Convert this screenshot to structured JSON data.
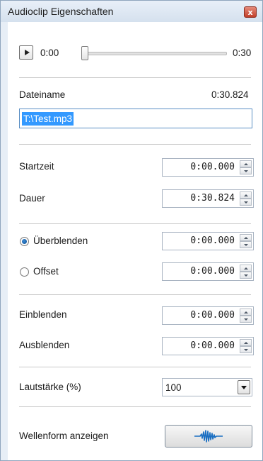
{
  "window": {
    "title": "Audioclip Eigenschaften",
    "close_label": "x"
  },
  "player": {
    "current_time": "0:00",
    "end_time": "0:30",
    "position_fraction": 0.0
  },
  "file": {
    "label": "Dateiname",
    "duration": "0:30.824",
    "value": "T:\\Test.mp3"
  },
  "timing": {
    "start_label": "Startzeit",
    "start_value": "0:00.000",
    "duration_label": "Dauer",
    "duration_value": "0:30.824"
  },
  "transition": {
    "crossfade_label": "Überblenden",
    "crossfade_value": "0:00.000",
    "crossfade_selected": true,
    "offset_label": "Offset",
    "offset_value": "0:00.000",
    "offset_selected": false
  },
  "fades": {
    "fade_in_label": "Einblenden",
    "fade_in_value": "0:00.000",
    "fade_out_label": "Ausblenden",
    "fade_out_value": "0:00.000"
  },
  "volume": {
    "label": "Lautstärke (%)",
    "value": "100"
  },
  "waveform": {
    "label": "Wellenform anzeigen",
    "icon": "waveform-icon"
  }
}
